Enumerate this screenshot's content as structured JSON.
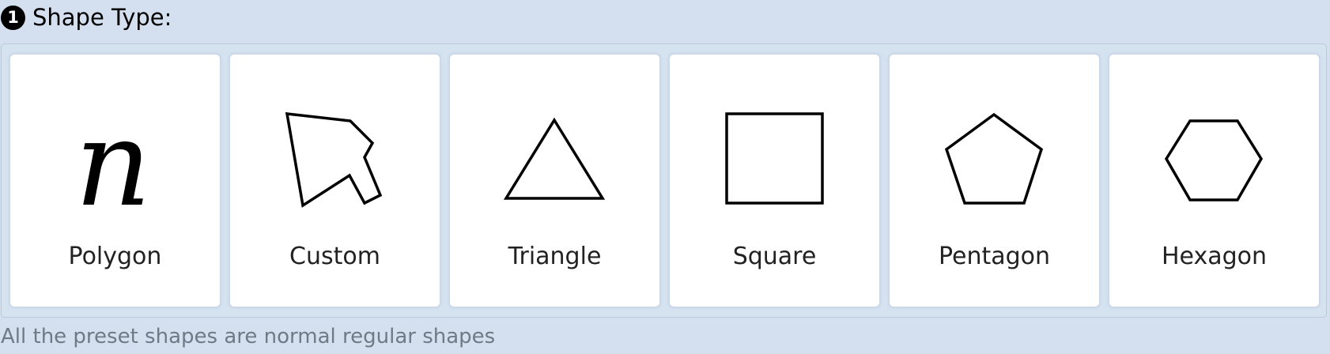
{
  "step": {
    "number": "1",
    "title": "Shape Type:"
  },
  "shapes": [
    {
      "label": "Polygon",
      "icon": "italic-n-icon",
      "glyph": "n"
    },
    {
      "label": "Custom",
      "icon": "custom-polygon-icon"
    },
    {
      "label": "Triangle",
      "icon": "triangle-icon"
    },
    {
      "label": "Square",
      "icon": "square-icon"
    },
    {
      "label": "Pentagon",
      "icon": "pentagon-icon"
    },
    {
      "label": "Hexagon",
      "icon": "hexagon-icon"
    }
  ],
  "note": "All the preset shapes are normal regular shapes",
  "colors": {
    "background": "#d4e0ef",
    "card": "#ffffff",
    "stroke": "#000000",
    "note": "#6f7a86"
  }
}
